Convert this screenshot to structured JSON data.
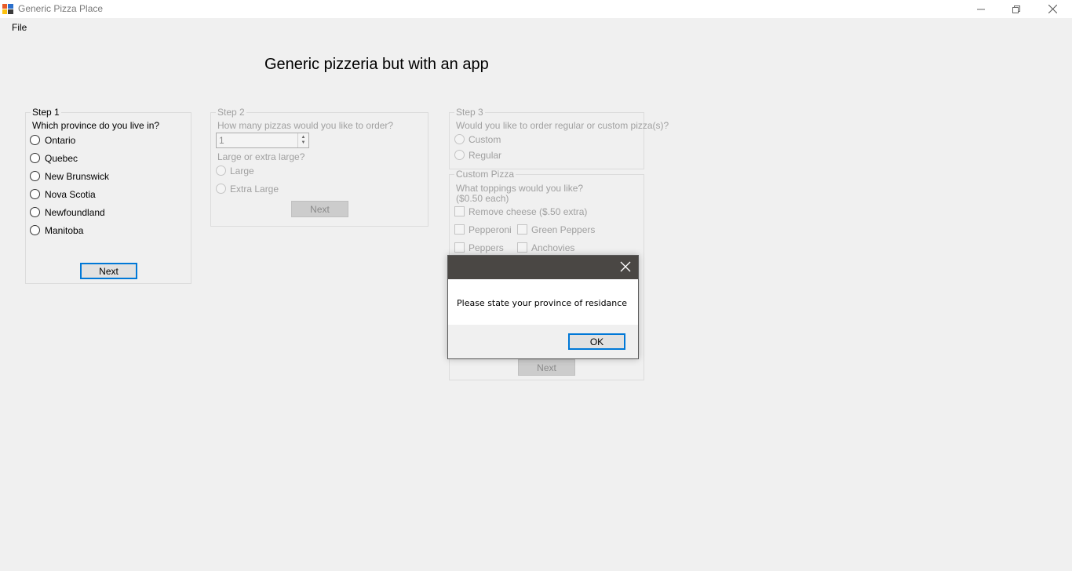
{
  "window": {
    "title": "Generic Pizza Place",
    "icon": "app-icon",
    "controls": [
      "minimize-icon",
      "restore-icon",
      "close-icon"
    ]
  },
  "menu": {
    "file": "File"
  },
  "heading": "Generic pizzeria but with an app",
  "step1": {
    "legend": "Step 1",
    "question": "Which province do you live in?",
    "options": [
      "Ontario",
      "Quebec",
      "New Brunswick",
      "Nova Scotia",
      "Newfoundland",
      "Manitoba"
    ],
    "next": "Next"
  },
  "step2": {
    "legend": "Step 2",
    "question": "How many pizzas would you like to order?",
    "quantity": "1",
    "size_question": "Large or extra large?",
    "options": [
      "Large",
      "Extra Large"
    ],
    "next": "Next"
  },
  "step3": {
    "legend": "Step 3",
    "question": "Would you like to order regular or custom pizza(s)?",
    "options": [
      "Custom",
      "Regular"
    ]
  },
  "custom": {
    "legend": "Custom Pizza",
    "question": "What toppings would you like?",
    "price_note": "($0.50 each)",
    "remove_cheese": "Remove cheese ($.50 extra)",
    "toppings": [
      "Pepperoni",
      "Green Peppers",
      "Peppers",
      "Anchovies"
    ],
    "next": "Next"
  },
  "dialog": {
    "message": "Please state your province of residance",
    "ok": "OK"
  },
  "colors": {
    "accent": "#0078d7",
    "dialog_titlebar": "#4a4744",
    "disabled_text": "#a0a0a0"
  }
}
